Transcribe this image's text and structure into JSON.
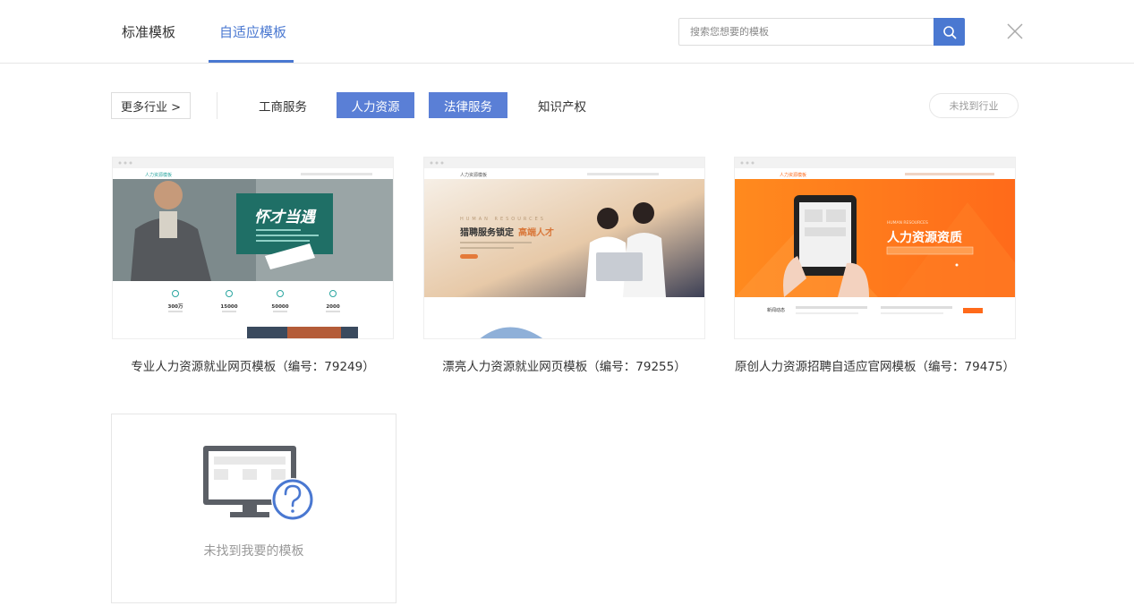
{
  "header": {
    "tabs": [
      {
        "label": "标准模板",
        "active": false
      },
      {
        "label": "自适应模板",
        "active": true
      }
    ],
    "search": {
      "placeholder": "搜索您想要的模板",
      "value": ""
    }
  },
  "filters": {
    "more_label": "更多行业 >",
    "chips": [
      {
        "label": "工商服务",
        "active": false
      },
      {
        "label": "人力资源",
        "active": true
      },
      {
        "label": "法律服务",
        "active": true
      },
      {
        "label": "知识产权",
        "active": false
      }
    ],
    "not_found_label": "未找到行业"
  },
  "templates": [
    {
      "caption": "专业人力资源就业网页模板（编号：79249）",
      "thumb": {
        "logo": "人力资源模板",
        "slogan": "怀才当遇",
        "stats": [
          "300万",
          "15000",
          "50000",
          "2000"
        ]
      }
    },
    {
      "caption": "漂亮人力资源就业网页模板（编号：79255）",
      "thumb": {
        "logo": "人力资源模板",
        "subtitle": "HUMAN RESOURCES",
        "slogan_a": "猎聘服务锁定",
        "slogan_b": "高端人才"
      }
    },
    {
      "caption": "原创人力资源招聘自适应官网模板（编号：79475）",
      "thumb": {
        "logo": "人力资源模板",
        "subtitle": "HUMAN RESOURCES",
        "slogan": "人力资源资质",
        "news_label": "新闻动态"
      }
    }
  ],
  "missing": {
    "label": "未找到我要的模板"
  },
  "colors": {
    "accent": "#4a78d1",
    "chip_active": "#5a7fd6",
    "orange": "#ff7a1f"
  }
}
